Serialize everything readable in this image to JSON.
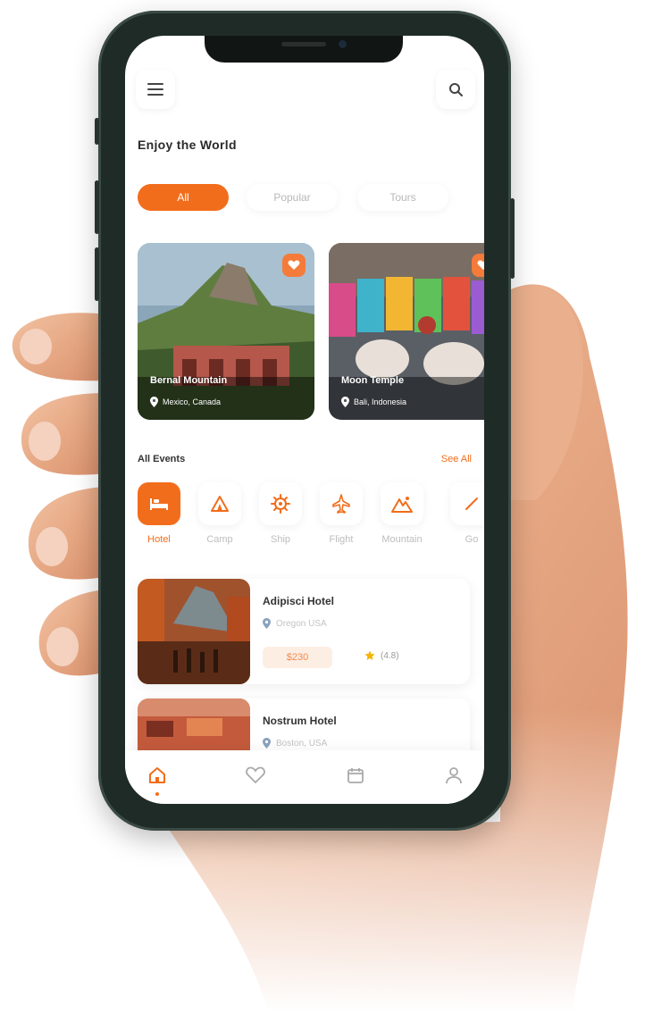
{
  "theme": {
    "accent": "#f26d1b",
    "accent_soft": "#fdeee4",
    "text_dark": "#333333",
    "text_muted": "#bdbdbd"
  },
  "header": {
    "menu_icon": "menu-icon",
    "search_icon": "search-icon",
    "title": "Enjoy the World"
  },
  "filters": [
    {
      "label": "All",
      "active": true
    },
    {
      "label": "Popular",
      "active": false
    },
    {
      "label": "Tours",
      "active": false
    }
  ],
  "featured": [
    {
      "title": "Bernal Mountain",
      "location": "Mexico, Canada",
      "favorite": true
    },
    {
      "title": "Moon Temple",
      "location": "Bali, Indonesia",
      "favorite": true
    }
  ],
  "events": {
    "label": "All Events",
    "see_all": "See All",
    "categories": [
      {
        "label": "Hotel",
        "icon": "bed-icon",
        "active": true
      },
      {
        "label": "Camp",
        "icon": "tent-icon",
        "active": false
      },
      {
        "label": "Ship",
        "icon": "ship-wheel-icon",
        "active": false
      },
      {
        "label": "Flight",
        "icon": "plane-icon",
        "active": false
      },
      {
        "label": "Mountain",
        "icon": "mountain-icon",
        "active": false
      },
      {
        "label": "Go",
        "icon": "more-icon",
        "active": false
      }
    ]
  },
  "hotels": [
    {
      "name": "Adipisci Hotel",
      "location": "Oregon USA",
      "price": "$230",
      "rating": "(4.8)"
    },
    {
      "name": "Nostrum Hotel",
      "location": "Boston, USA"
    }
  ],
  "tabbar": [
    {
      "icon": "home-icon",
      "active": true
    },
    {
      "icon": "heart-icon",
      "active": false
    },
    {
      "icon": "calendar-icon",
      "active": false
    },
    {
      "icon": "profile-icon",
      "active": false
    }
  ]
}
